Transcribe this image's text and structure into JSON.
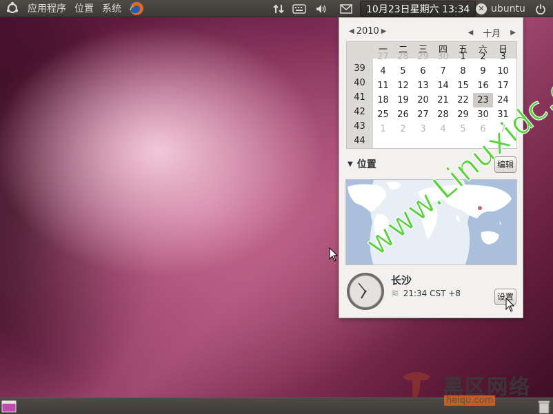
{
  "top_panel": {
    "menus": [
      "应用程序",
      "位置",
      "系统"
    ],
    "clock": "10月23日星期六 13:34",
    "user": "ubuntu"
  },
  "calendar": {
    "year": "2010",
    "month": "十月",
    "weekday_headers": [
      "一",
      "二",
      "三",
      "四",
      "五",
      "六",
      "日"
    ],
    "weeks": [
      {
        "week": "39",
        "days": [
          {
            "d": "27",
            "dim": true
          },
          {
            "d": "28",
            "dim": true
          },
          {
            "d": "29",
            "dim": true
          },
          {
            "d": "30",
            "dim": true
          },
          {
            "d": "1"
          },
          {
            "d": "2"
          },
          {
            "d": "3"
          }
        ]
      },
      {
        "week": "40",
        "days": [
          {
            "d": "4"
          },
          {
            "d": "5"
          },
          {
            "d": "6"
          },
          {
            "d": "7"
          },
          {
            "d": "8"
          },
          {
            "d": "9"
          },
          {
            "d": "10"
          }
        ]
      },
      {
        "week": "41",
        "days": [
          {
            "d": "11"
          },
          {
            "d": "12"
          },
          {
            "d": "13"
          },
          {
            "d": "14"
          },
          {
            "d": "15"
          },
          {
            "d": "16"
          },
          {
            "d": "17"
          }
        ]
      },
      {
        "week": "42",
        "days": [
          {
            "d": "18"
          },
          {
            "d": "19"
          },
          {
            "d": "20"
          },
          {
            "d": "21"
          },
          {
            "d": "22"
          },
          {
            "d": "23",
            "today": true
          },
          {
            "d": "24"
          }
        ]
      },
      {
        "week": "43",
        "days": [
          {
            "d": "25"
          },
          {
            "d": "26"
          },
          {
            "d": "27"
          },
          {
            "d": "28"
          },
          {
            "d": "29"
          },
          {
            "d": "30"
          },
          {
            "d": "31"
          }
        ]
      },
      {
        "week": "44",
        "days": [
          {
            "d": "1",
            "dim": true
          },
          {
            "d": "2",
            "dim": true
          },
          {
            "d": "3",
            "dim": true
          },
          {
            "d": "4",
            "dim": true
          },
          {
            "d": "5",
            "dim": true
          },
          {
            "d": "6",
            "dim": true
          },
          {
            "d": "7",
            "dim": true
          }
        ]
      }
    ]
  },
  "locations": {
    "title": "位置",
    "edit_label": "编辑",
    "city": "长沙",
    "time": "21:34 CST +8",
    "settings_label": "设置"
  },
  "watermark": {
    "url": "www.Linuxidc.com",
    "cn": "黑区网络",
    "domain": "heiqu.com"
  },
  "colors": {
    "panel": "#3c3b37",
    "popup_bg": "#f2f1f0",
    "watermark_green": "#58d23a"
  }
}
